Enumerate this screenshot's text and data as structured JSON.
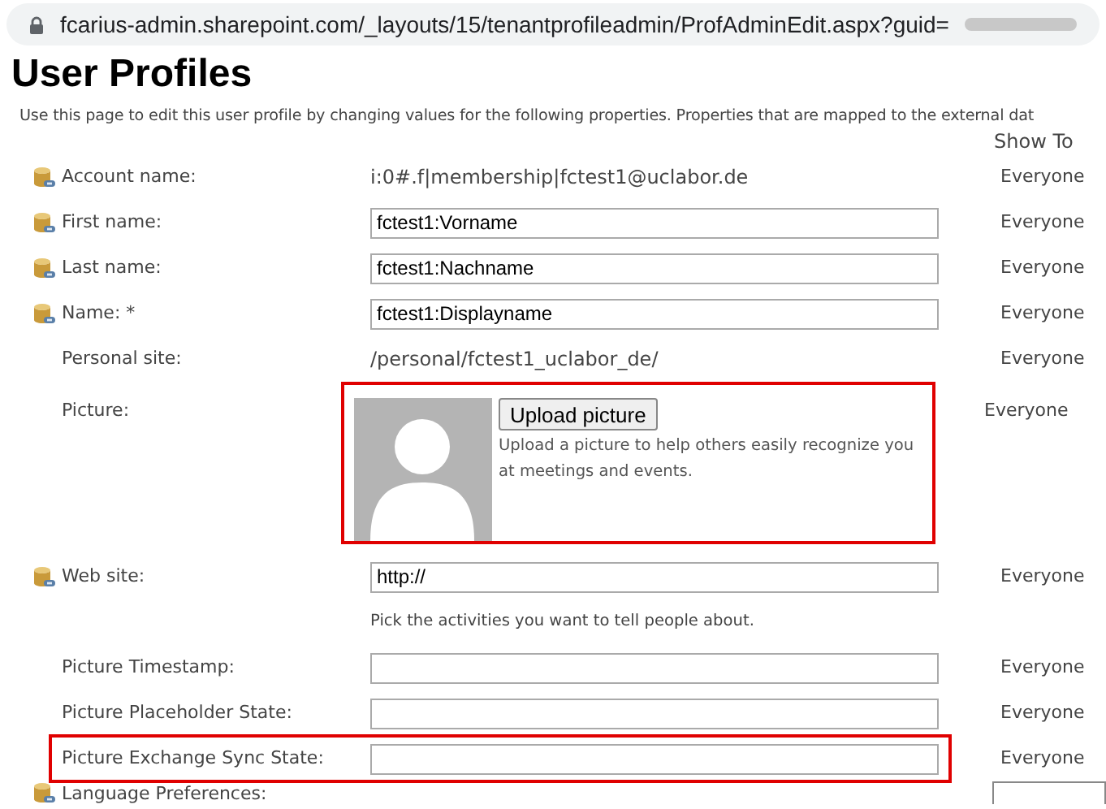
{
  "address_bar": {
    "url": "fcarius-admin.sharepoint.com/_layouts/15/tenantprofileadmin/ProfAdminEdit.aspx?guid="
  },
  "title": "User Profiles",
  "description": "Use this page to edit this user profile by changing values for the following properties. Properties that are mapped to the external dat",
  "column_header": "Show To",
  "rows": [
    {
      "kind": "text",
      "mapped": true,
      "label": "Account name:",
      "value": "i:0#.f|membership|fctest1@uclabor.de",
      "show_to": "Everyone",
      "highlighted": false
    },
    {
      "kind": "input",
      "mapped": true,
      "label": "First name:",
      "value": "fctest1:Vorname",
      "show_to": "Everyone",
      "highlighted": false
    },
    {
      "kind": "input",
      "mapped": true,
      "label": "Last name:",
      "value": "fctest1:Nachname",
      "show_to": "Everyone",
      "highlighted": false
    },
    {
      "kind": "input",
      "mapped": true,
      "label": "Name: *",
      "value": "fctest1:Displayname",
      "show_to": "Everyone",
      "highlighted": false
    },
    {
      "kind": "text",
      "mapped": false,
      "label": "Personal site:",
      "value": "/personal/fctest1_uclabor_de/",
      "show_to": "Everyone",
      "highlighted": false
    },
    {
      "kind": "picture",
      "mapped": false,
      "label": "Picture:",
      "button": "Upload picture",
      "hint": "Upload a picture to help others easily recognize you at meetings and events.",
      "show_to": "Everyone",
      "highlighted": true
    },
    {
      "kind": "input",
      "mapped": true,
      "label": "Web site:",
      "value": "http://",
      "show_to": "Everyone",
      "highlighted": false
    },
    {
      "kind": "note",
      "text": "Pick the activities you want to tell people about."
    },
    {
      "kind": "input",
      "mapped": false,
      "label": "Picture Timestamp:",
      "value": "",
      "show_to": "Everyone",
      "highlighted": false
    },
    {
      "kind": "input",
      "mapped": false,
      "label": "Picture Placeholder State:",
      "value": "",
      "show_to": "Everyone",
      "highlighted": false
    },
    {
      "kind": "input",
      "mapped": false,
      "label": "Picture Exchange Sync State:",
      "value": "",
      "show_to": "Everyone",
      "highlighted": true
    },
    {
      "kind": "select",
      "mapped": true,
      "label": "Language Preferences:",
      "highlighted": false
    }
  ]
}
